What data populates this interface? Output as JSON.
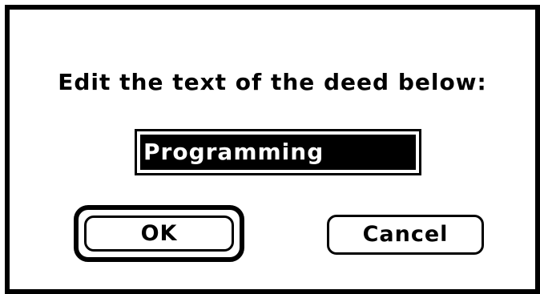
{
  "dialog": {
    "prompt": "Edit the text of the deed below:",
    "field_value": "Programming",
    "ok_label": "OK",
    "cancel_label": "Cancel"
  },
  "colors": {
    "background": "#ffffff",
    "foreground": "#000000",
    "selection": "#000000",
    "selection_text": "#ffffff"
  }
}
